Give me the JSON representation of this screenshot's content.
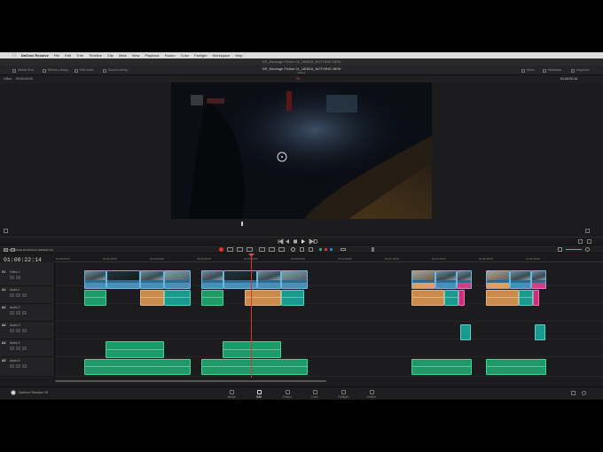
{
  "menubar": {
    "app_name": "DaVinci Resolve",
    "items": [
      "File",
      "Edit",
      "Trim",
      "Timeline",
      "Clip",
      "Mark",
      "View",
      "Playback",
      "Fusion",
      "Color",
      "Fairlight",
      "Workspace",
      "Help"
    ]
  },
  "window": {
    "title": "DR_Montage Fiction 01_180816_NOTHING NEW"
  },
  "toolbar": {
    "media_pool": "Media Pool",
    "effects_library": "Effects Library",
    "edit_index": "Edit Index",
    "sound_library": "Sound Library",
    "project_name": "DR_Montage Fiction 01_180816_NOTHING NEW",
    "project_sub": "Edited",
    "mixer": "Mixer",
    "metadata": "Metadata",
    "inspector": "Inspector"
  },
  "viewer": {
    "zoom": "Fit",
    "source_timecode": "00:00:00:00",
    "record_timecode": "01:00:22:14",
    "timeline_label": "Video"
  },
  "timeline": {
    "name": "DR_MONTAGE FICTION 01 (180816) NOTHING NEW",
    "timecode": "01:00:22:14",
    "ruler_ticks": [
      "01:00:00:00",
      "01:00:10:00",
      "01:00:20:00",
      "01:00:30:00",
      "01:00:40:00",
      "01:00:50:00",
      "01:01:00:00",
      "01:01:10:00",
      "01:01:20:00",
      "01:01:30:00",
      "01:01:40:00"
    ],
    "tracks": [
      {
        "id": "V1",
        "name": "Video 1",
        "type": "video"
      },
      {
        "id": "A1",
        "name": "Audio 1",
        "type": "audio"
      },
      {
        "id": "A2",
        "name": "Audio 2",
        "type": "audio"
      },
      {
        "id": "A3",
        "name": "Audio 3",
        "type": "audio"
      },
      {
        "id": "A4",
        "name": "Audio 4",
        "type": "audio"
      },
      {
        "id": "A5",
        "name": "Audio 5",
        "type": "audio"
      }
    ]
  },
  "pages": [
    "Media",
    "Edit",
    "Fusion",
    "Color",
    "Fairlight",
    "Deliver"
  ],
  "active_page": "Edit",
  "brand": "DaVinci Resolve 15",
  "colors": {
    "video_clip": "#2f6a8d",
    "audio_orange": "#c98a4a",
    "audio_green": "#1e9a68",
    "audio_teal": "#1a9a8f",
    "audio_pink": "#c9307a",
    "playhead": "#d33333"
  }
}
